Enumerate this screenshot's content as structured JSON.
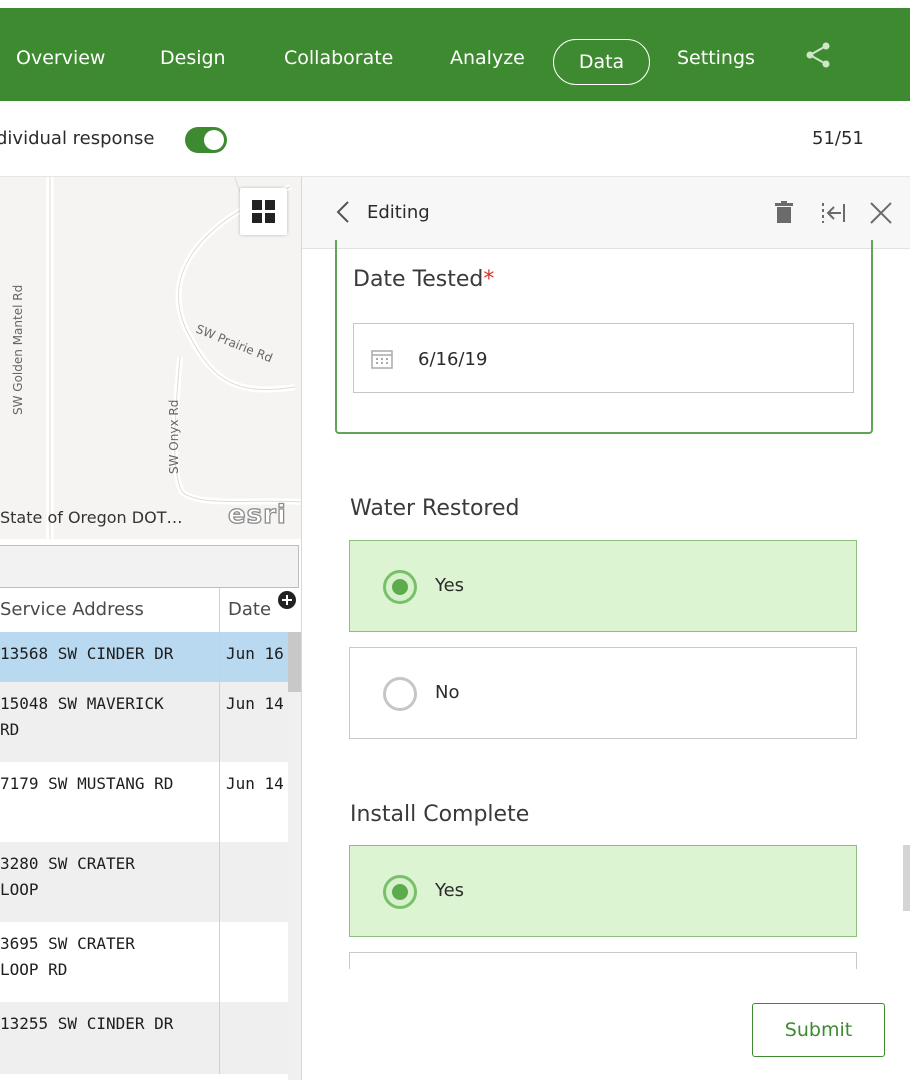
{
  "nav": {
    "items": [
      {
        "label": "Overview"
      },
      {
        "label": "Design"
      },
      {
        "label": "Collaborate"
      },
      {
        "label": "Analyze"
      },
      {
        "label": "Data"
      },
      {
        "label": "Settings"
      }
    ],
    "active": "Data",
    "share_icon": "share-icon",
    "accent_color": "#3e8a30"
  },
  "subbar": {
    "toggle_label": "dividual response",
    "toggle_on": true,
    "counter": "51/51"
  },
  "map": {
    "roads": [
      "SW Golden Mantel Rd",
      "SW Prairie Rd",
      "SW Onyx Rd"
    ],
    "attribution": "State of Oregon DOT…",
    "logo": "esri"
  },
  "table": {
    "headers": [
      "Service Address",
      "Date"
    ],
    "rows": [
      {
        "address": "13568 SW CINDER DR",
        "date": "Jun 16",
        "selected": true
      },
      {
        "address": "15048 SW MAVERICK\nRD",
        "date": "Jun 14"
      },
      {
        "address": "7179 SW MUSTANG RD",
        "date": "Jun 14"
      },
      {
        "address": "3280 SW CRATER\nLOOP",
        "date": ""
      },
      {
        "address": "3695 SW CRATER\nLOOP RD",
        "date": ""
      },
      {
        "address": "13255 SW CINDER DR",
        "date": ""
      }
    ]
  },
  "editor": {
    "title": "Editing",
    "questions": {
      "date_tested": {
        "label": "Date Tested",
        "required_mark": "*",
        "value": "6/16/19"
      },
      "water_restored": {
        "label": "Water Restored",
        "options": [
          "Yes",
          "No"
        ],
        "selected": "Yes"
      },
      "install_complete": {
        "label": "Install Complete",
        "options": [
          "Yes"
        ],
        "selected": "Yes"
      }
    },
    "submit_label": "Submit"
  }
}
